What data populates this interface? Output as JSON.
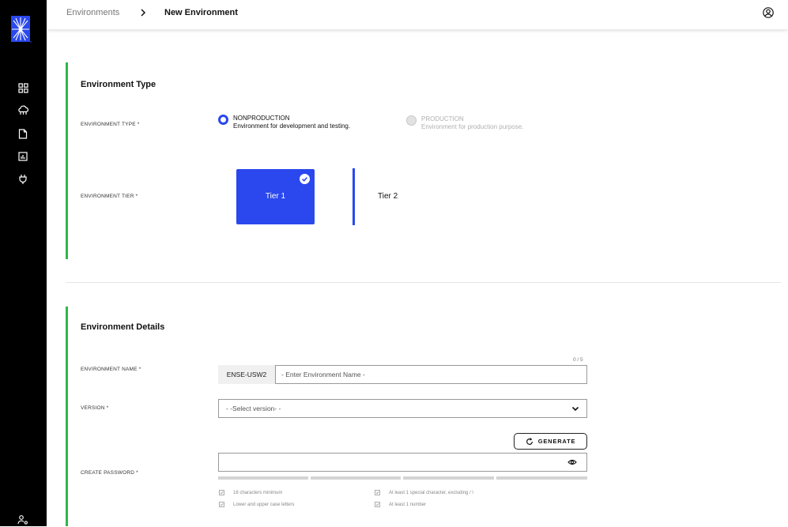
{
  "colors": {
    "accent": "#2a48ee",
    "section_bar": "#2db84b",
    "sidebar": "#000000"
  },
  "sidebar": {
    "logo": "radiant-star-logo",
    "items": [
      {
        "icon": "dashboard-grid-icon"
      },
      {
        "icon": "cloud-network-icon"
      },
      {
        "icon": "document-icon"
      },
      {
        "icon": "analytics-chart-icon"
      },
      {
        "icon": "plug-icon"
      }
    ],
    "bottom_icon": "user-settings-icon"
  },
  "breadcrumb": {
    "root": "Environments",
    "current": "New Environment"
  },
  "header": {
    "profile_icon": "user-circle-icon"
  },
  "environment_type_section": {
    "title": "Environment Type",
    "type_label": "ENVIRONMENT TYPE *",
    "options": [
      {
        "title": "NONPRODUCTION",
        "description": "Environment for development and testing.",
        "selected": true,
        "disabled": false
      },
      {
        "title": "PRODUCTION",
        "description": "Environment for production purpose.",
        "selected": false,
        "disabled": true
      }
    ],
    "tier_label": "ENVIRONMENT TIER *",
    "tiers": [
      {
        "label": "Tier 1",
        "selected": true
      },
      {
        "label": "Tier 2",
        "selected": false
      }
    ]
  },
  "environment_details_section": {
    "title": "Environment Details",
    "name_label": "ENVIRONMENT NAME *",
    "name_prefix": "ENSE-USW2",
    "name_placeholder": "- Enter Environment Name -",
    "name_value": "",
    "name_counter": "0 / 5",
    "version_label": "VERSION *",
    "version_value": "- -Select version- -",
    "password_label": "CREATE PASSWORD *",
    "generate_label": "GENERATE",
    "password_value": "",
    "password_strength_filled": 0,
    "requirements": [
      "16 characters minimum",
      "At least 1 special character, excluding / \\",
      "Lower and upper case letters",
      "At least 1 number"
    ]
  }
}
